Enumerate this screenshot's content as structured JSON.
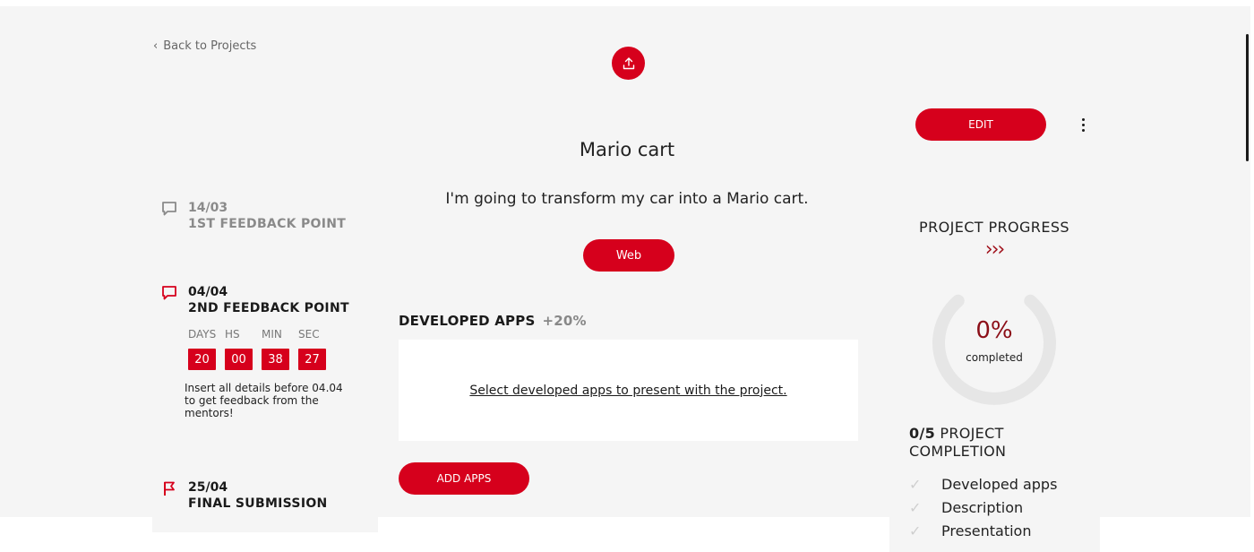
{
  "nav": {
    "back_label": "Back to Projects"
  },
  "project": {
    "title": "Mario cart",
    "description": "I'm going to transform my car into a Mario cart.",
    "tag": "Web"
  },
  "developed_apps": {
    "heading": "DEVELOPED APPS",
    "bonus": "+20%",
    "select_link": "Select developed apps to present with the project.",
    "add_button": "ADD APPS"
  },
  "timeline": {
    "items": [
      {
        "date": "14/03",
        "label": "1ST FEEDBACK POINT",
        "icon": "comment-icon",
        "state": "past"
      },
      {
        "date": "04/04",
        "label": "2ND FEEDBACK POINT",
        "icon": "comment-icon",
        "state": "active"
      },
      {
        "date": "25/04",
        "label": "FINAL SUBMISSION",
        "icon": "flag-icon",
        "state": "upcoming"
      }
    ],
    "countdown": {
      "labels": [
        "DAYS",
        "HS",
        "MIN",
        "SEC"
      ],
      "values": [
        "20",
        "00",
        "38",
        "27"
      ],
      "note": "Insert all details before 04.04 to get feedback from the mentors!"
    }
  },
  "sidebar": {
    "edit_label": "EDIT",
    "progress_title": "PROJECT PROGRESS",
    "progress_chevrons": "›››",
    "progress_percent": "0%",
    "progress_sub": "completed",
    "progress_fraction": 0,
    "completion_count": "0/5",
    "completion_label": "PROJECT",
    "completion_label2": "COMPLETION",
    "checklist": [
      "Developed apps",
      "Description",
      "Presentation"
    ]
  },
  "colors": {
    "accent": "#d6001c",
    "dark_accent": "#8b0e17",
    "background": "#f5f5f5"
  }
}
